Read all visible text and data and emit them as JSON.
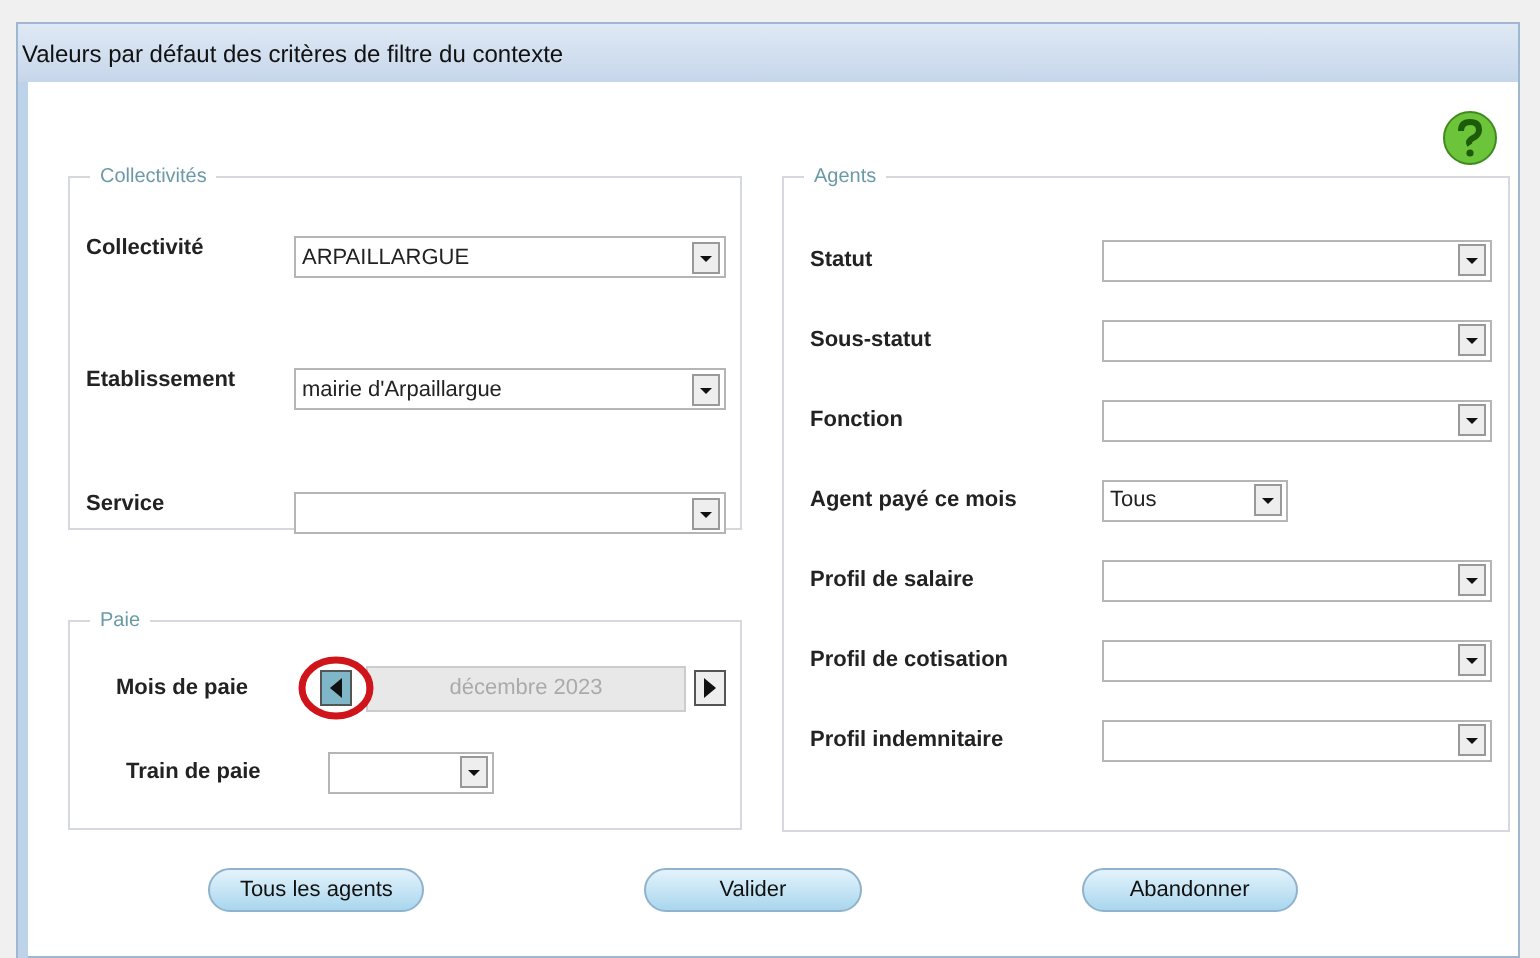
{
  "window": {
    "title": "Valeurs par défaut des critères de filtre du contexte"
  },
  "collectivites": {
    "title": "Collectivités",
    "fields": [
      {
        "label": "Collectivité",
        "value": "ARPAILLARGUE"
      },
      {
        "label": "Etablissement",
        "value": "mairie d'Arpaillargue"
      },
      {
        "label": "Service"
      }
    ]
  },
  "paie": {
    "title": "Paie",
    "month": {
      "label": "Mois de paie",
      "value": "décembre 2023",
      "disabled": true,
      "prev_highlighted": true
    },
    "train": {
      "label": "Train de paie"
    }
  },
  "agents": {
    "title": "Agents",
    "fields": [
      {
        "label": "Statut",
        "kind": "wide"
      },
      {
        "label": "Sous-statut",
        "kind": "wide"
      },
      {
        "label": "Fonction",
        "kind": "wide"
      },
      {
        "label": "Agent payé ce mois",
        "value": "Tous",
        "kind": "short"
      },
      {
        "label": "Profil de salaire",
        "kind": "wide"
      },
      {
        "label": "Profil de cotisation",
        "kind": "wide"
      },
      {
        "label": "Profil indemnitaire",
        "kind": "wide"
      }
    ]
  },
  "buttons": [
    "Tous les agents",
    "Valider",
    "Abandonner"
  ]
}
